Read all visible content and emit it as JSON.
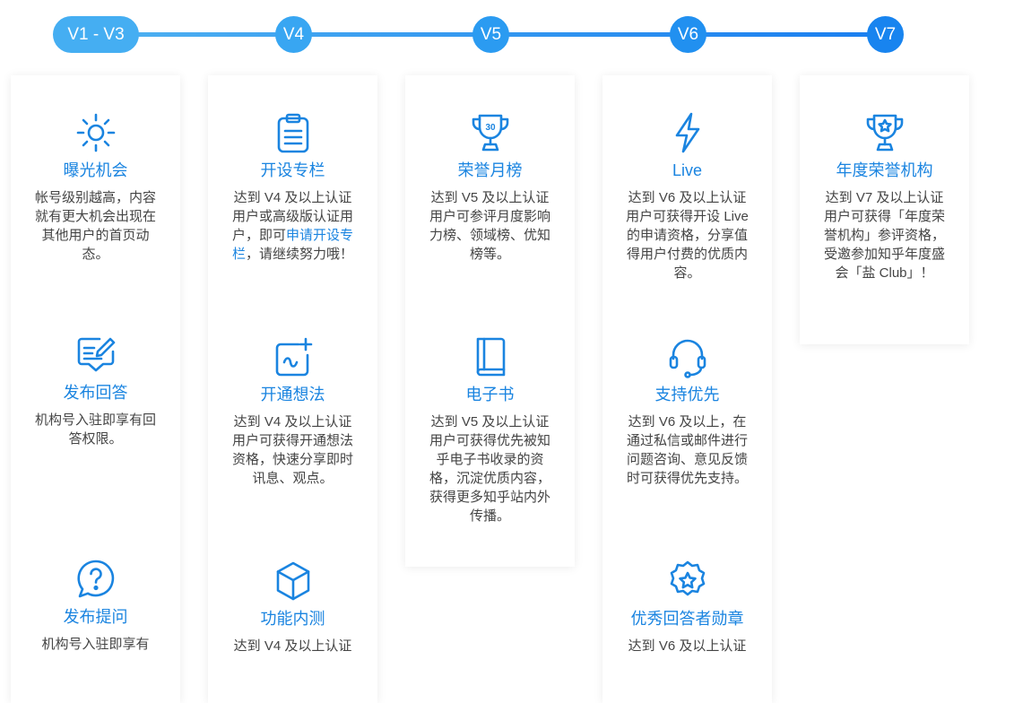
{
  "colors": {
    "accent": "#1a84e0",
    "text": "#444444",
    "track_start": "#4fb2f1",
    "track_end": "#1a7ef0"
  },
  "levels": [
    "V1 - V3",
    "V4",
    "V5",
    "V6",
    "V7"
  ],
  "columns": [
    {
      "features": [
        {
          "icon": "sun-icon",
          "title": "曝光机会",
          "desc": "帐号级别越高，内容就有更大机会出现在其他用户的首页动态。"
        },
        {
          "icon": "edit-answer-icon",
          "title": "发布回答",
          "desc": "机构号入驻即享有回答权限。"
        },
        {
          "icon": "question-bubble-icon",
          "title": "发布提问",
          "desc": "机构号入驻即享有"
        }
      ]
    },
    {
      "features": [
        {
          "icon": "clipboard-icon",
          "title": "开设专栏",
          "desc_before": "达到 V4 及以上认证用户或高级版认证用户，即可",
          "desc_link": "申请开设专栏",
          "desc_after": "，请继续努力哦！"
        },
        {
          "icon": "add-idea-icon",
          "title": "开通想法",
          "desc": "达到 V4 及以上认证用户可获得开通想法资格，快速分享即时讯息、观点。"
        },
        {
          "icon": "cube-icon",
          "title": "功能内测",
          "desc": "达到 V4 及以上认证"
        }
      ]
    },
    {
      "features": [
        {
          "icon": "trophy-30-icon",
          "title": "荣誉月榜",
          "desc": "达到 V5 及以上认证用户可参评月度影响力榜、领域榜、优知榜等。"
        },
        {
          "icon": "book-icon",
          "title": "电子书",
          "desc": "达到 V5 及以上认证用户可获得优先被知乎电子书收录的资格，沉淀优质内容，获得更多知乎站内外传播。"
        }
      ]
    },
    {
      "features": [
        {
          "icon": "lightning-icon",
          "title": "Live",
          "desc": "达到 V6 及以上认证用户可获得开设 Live 的申请资格，分享值得用户付费的优质内容。"
        },
        {
          "icon": "headset-icon",
          "title": "支持优先",
          "desc": "达到 V6 及以上，在通过私信或邮件进行问题咨询、意见反馈时可获得优先支持。"
        },
        {
          "icon": "star-badge-icon",
          "title": "优秀回答者勋章",
          "desc": "达到 V6 及以上认证"
        }
      ]
    },
    {
      "features": [
        {
          "icon": "trophy-star-icon",
          "title": "年度荣誉机构",
          "desc": "达到 V7 及以上认证用户可获得「年度荣誉机构」参评资格，受邀参加知乎年度盛会「盐 Club」！"
        }
      ]
    }
  ]
}
